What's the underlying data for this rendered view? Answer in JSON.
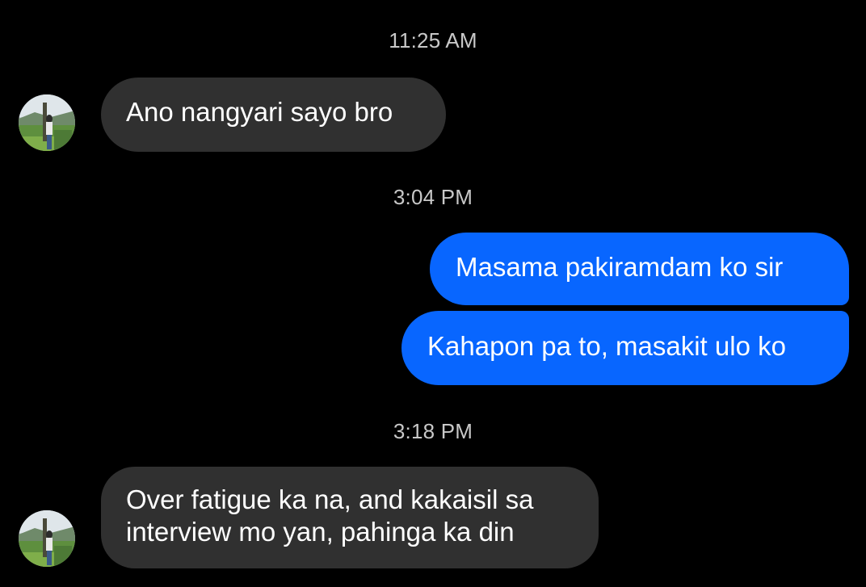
{
  "thread": {
    "timestamps": [
      "11:25 AM",
      "3:04 PM",
      "3:18 PM"
    ],
    "messages": [
      {
        "sender": "contact",
        "text": "Ano nangyari sayo bro"
      },
      {
        "sender": "me",
        "text": "Masama pakiramdam ko sir"
      },
      {
        "sender": "me",
        "text": "Kahapon pa to, masakit ulo ko"
      },
      {
        "sender": "contact",
        "text": "Over fatigue ka na, and kakaisil sa interview mo yan, pahinga ka din",
        "lines": [
          "Over fatigue ka na, and kakaisil sa",
          "interview mo yan, pahinga ka din"
        ]
      }
    ]
  },
  "colors": {
    "background": "#000000",
    "incoming_bubble": "#303030",
    "outgoing_bubble": "#0866ff",
    "timestamp_text": "#c8c8c8",
    "message_text": "#ffffff"
  },
  "icons": {
    "contact_avatar": "contact-avatar-photo"
  }
}
